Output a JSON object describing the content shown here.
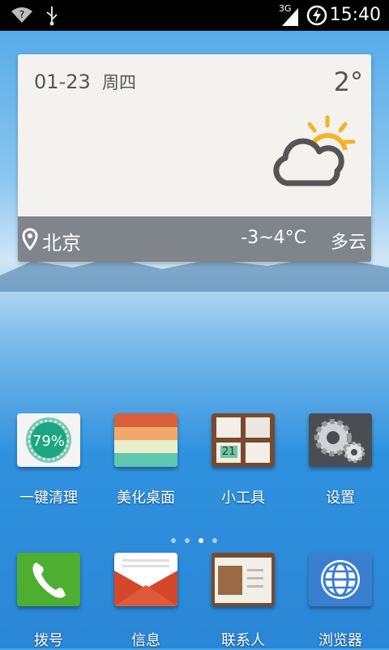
{
  "status_bar": {
    "time": "15:40",
    "network": "3G",
    "icons": [
      "wifi-question-icon",
      "usb-icon",
      "signal-icon",
      "charging-icon"
    ]
  },
  "weather_widget": {
    "date": "01-23",
    "weekday": "周四",
    "temperature": "2°",
    "city": "北京",
    "range": "-3~4°C",
    "condition": "多云",
    "icon": "partly-cloudy-icon"
  },
  "home_apps": [
    {
      "label": "一键清理",
      "icon": "cleaner-icon",
      "badge": "79%"
    },
    {
      "label": "美化桌面",
      "icon": "theme-icon"
    },
    {
      "label": "小工具",
      "icon": "widgets-icon",
      "badge": "21"
    },
    {
      "label": "设置",
      "icon": "settings-gear-icon"
    }
  ],
  "page_indicator": {
    "count": 4,
    "active": 2
  },
  "dock_apps": [
    {
      "label": "拨号",
      "icon": "phone-icon"
    },
    {
      "label": "信息",
      "icon": "message-icon"
    },
    {
      "label": "联系人",
      "icon": "contacts-icon"
    },
    {
      "label": "浏览器",
      "icon": "browser-globe-icon"
    }
  ],
  "colors": {
    "status_bar": "#000000",
    "phone_green": "#4caf2f",
    "message_red": "#d4472a",
    "browser_blue": "#3a7fcf"
  }
}
